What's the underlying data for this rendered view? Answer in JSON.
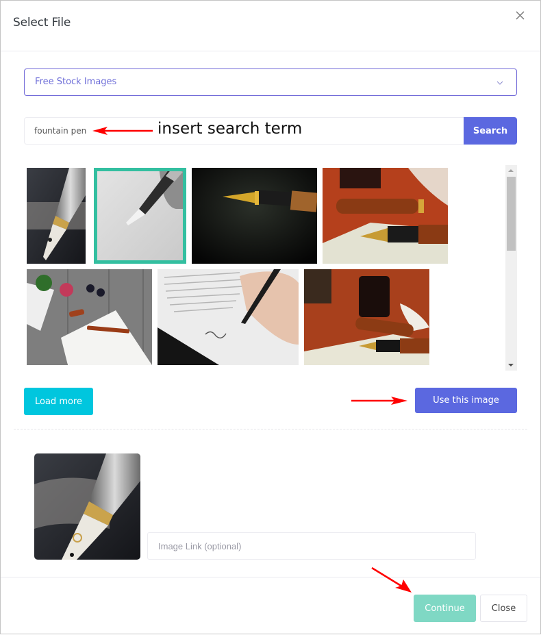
{
  "modal": {
    "title": "Select File",
    "close_icon": "close-x-icon"
  },
  "source_select": {
    "value": "Free Stock Images",
    "icon": "chevron-down-icon"
  },
  "search": {
    "value": "fountain pen",
    "button_label": "Search"
  },
  "annotations": {
    "search_hint": "insert search term",
    "arrows": [
      "arrow-to-search-input",
      "arrow-to-use-image-button",
      "arrow-to-continue-button"
    ]
  },
  "gallery": {
    "images": [
      {
        "id": "img-1",
        "alt": "Fountain pen nib close-up silver and gold",
        "selected": false
      },
      {
        "id": "img-2",
        "alt": "Hand writing with silver fountain pen on white paper",
        "selected": true
      },
      {
        "id": "img-3",
        "alt": "Gold fountain pen on dark paper",
        "selected": false
      },
      {
        "id": "img-4",
        "alt": "Wooden fountain pen with feather on orange background",
        "selected": false
      },
      {
        "id": "img-5",
        "alt": "Paper, rose and fountain pen on wooden table",
        "selected": false
      },
      {
        "id": "img-6",
        "alt": "Hand signing document with fountain pen",
        "selected": false
      },
      {
        "id": "img-7",
        "alt": "Ink bottle, feather and fountain pens on orange background",
        "selected": false
      }
    ]
  },
  "actions": {
    "load_more": "Load more",
    "use_image": "Use this image"
  },
  "selection": {
    "preview_alt": "Fountain pen nib close-up silver and gold",
    "link_placeholder": "Image Link (optional)",
    "link_value": ""
  },
  "footer": {
    "continue_label": "Continue",
    "close_label": "Close"
  },
  "colors": {
    "primary": "#5b68e0",
    "info": "#00c6de",
    "success_disabled": "#7fd8c4",
    "selected_outline": "#33bfa0",
    "annotation_arrow": "#ff0000"
  }
}
